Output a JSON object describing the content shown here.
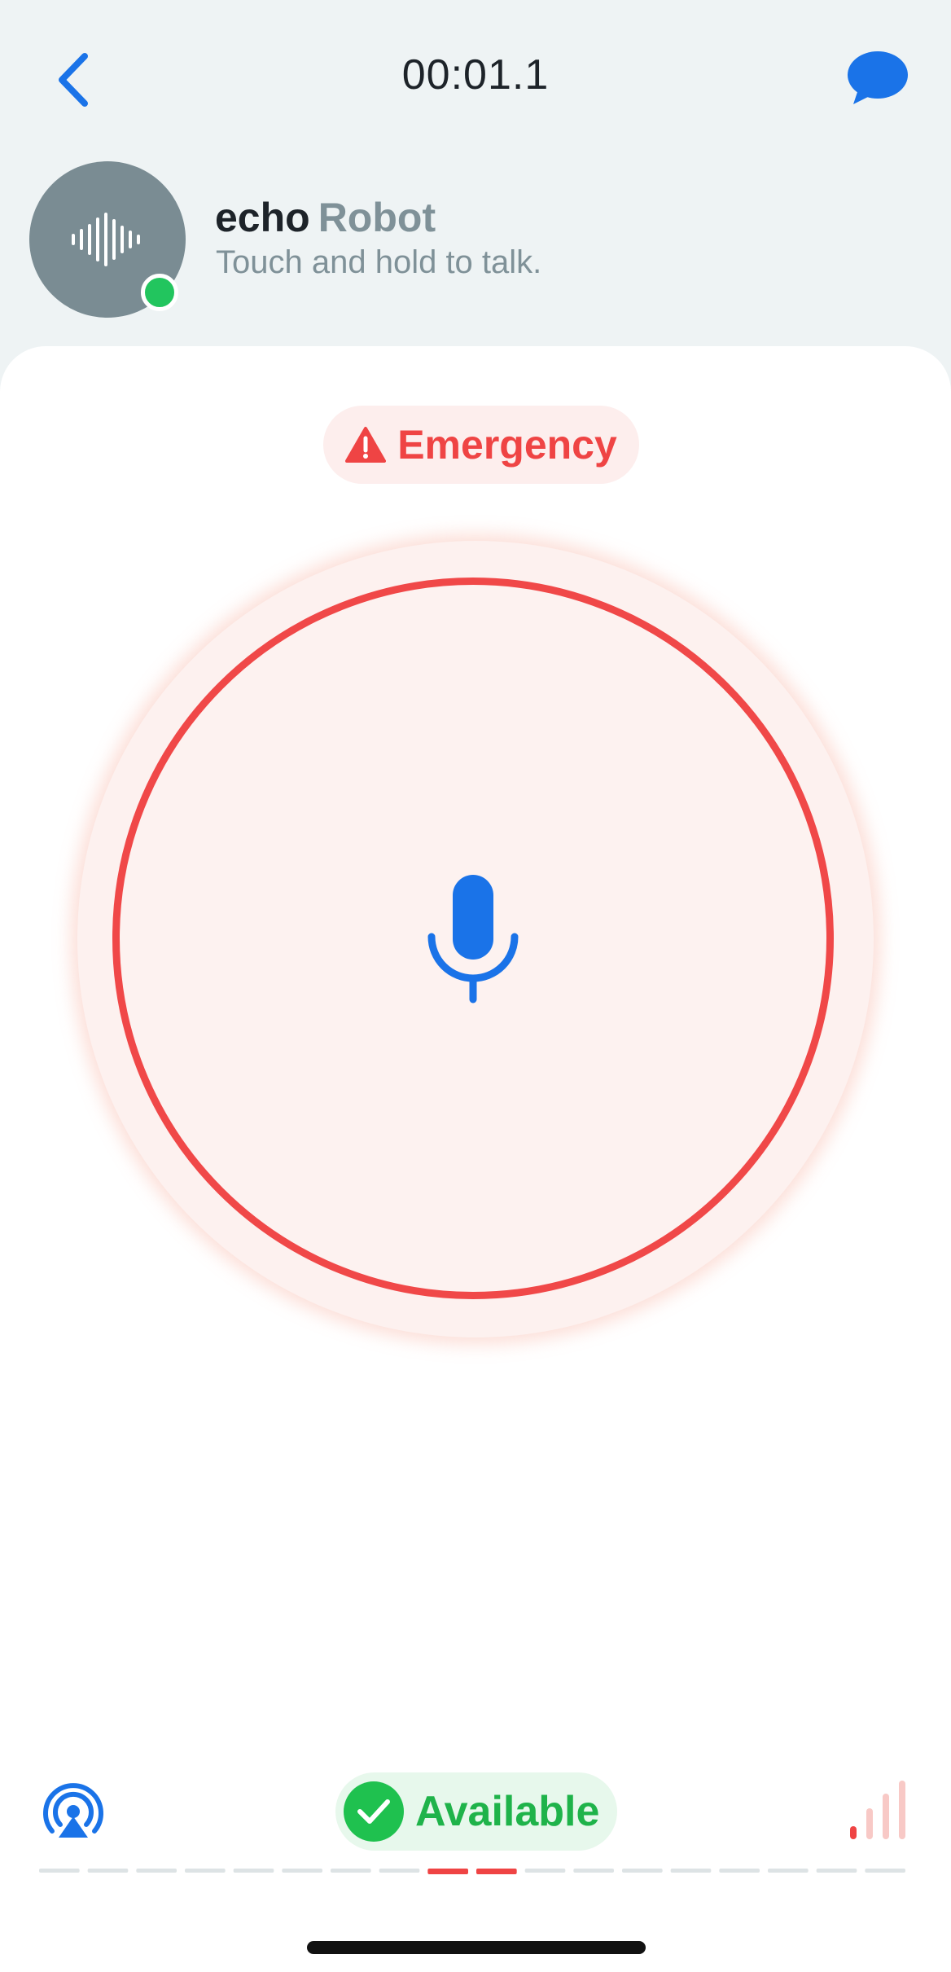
{
  "header": {
    "timer": "00:01.1",
    "back_icon": "chevron-left-icon",
    "chat_icon": "speech-bubble-icon"
  },
  "contact": {
    "name": "echo",
    "role": "Robot",
    "hint": "Touch and hold to talk.",
    "avatar_icon": "waveform-icon",
    "presence": "online"
  },
  "main": {
    "emergency_label": "Emergency",
    "emergency_icon": "warning-triangle-icon",
    "talk_icon": "microphone-icon"
  },
  "footer": {
    "status_label": "Available",
    "status_icon": "checkmark-icon",
    "broadcast_icon": "broadcast-icon",
    "signal_icon": "signal-bars-icon",
    "signal_level": 1,
    "signal_max": 4,
    "timeline_segments": 18,
    "timeline_active": [
      8,
      9
    ]
  },
  "colors": {
    "accent": "#1a73e8",
    "emergency": "#f04848",
    "available": "#1fc14f",
    "online": "#22c55e",
    "header_bg": "#eef3f4"
  }
}
